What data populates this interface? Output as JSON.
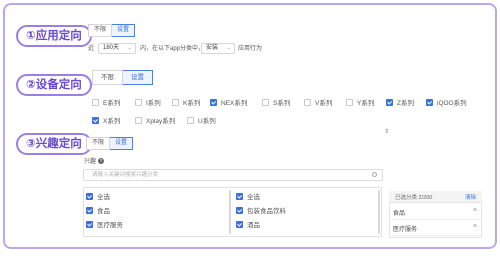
{
  "sections": {
    "app_targeting": "①应用定向",
    "device_targeting": "②设备定向",
    "interest_targeting": "③兴趣定向"
  },
  "app": {
    "options": [
      "不限",
      "设置"
    ],
    "selected": "设置",
    "rule_prefix": "近",
    "days_value": "180天",
    "rule_middle": "内，在以下app分类中，有",
    "action_value": "安装",
    "rule_suffix": "应用行为"
  },
  "device": {
    "options": [
      "不限",
      "设置"
    ],
    "selected": "设置",
    "series": [
      {
        "label": "E系列",
        "checked": false
      },
      {
        "label": "I系列",
        "checked": false
      },
      {
        "label": "K系列",
        "checked": false
      },
      {
        "label": "NEX系列",
        "checked": true
      },
      {
        "label": "S系列",
        "checked": false
      },
      {
        "label": "V系列",
        "checked": false
      },
      {
        "label": "Y系列",
        "checked": false
      },
      {
        "label": "Z系列",
        "checked": true
      },
      {
        "label": "iQOO系列",
        "checked": true
      },
      {
        "label": "X系列",
        "checked": true
      },
      {
        "label": "Xplay系列",
        "checked": false
      },
      {
        "label": "U系列",
        "checked": false
      }
    ]
  },
  "interest": {
    "options": [
      "不限",
      "设置"
    ],
    "selected": "设置",
    "field_label": "兴趣",
    "search_placeholder": "请输入关键词搜索兴趣分类",
    "col1": [
      {
        "label": "全选",
        "checked": true
      },
      {
        "label": "食品",
        "checked": true
      },
      {
        "label": "医疗服务",
        "checked": true
      }
    ],
    "col2": [
      {
        "label": "全选",
        "checked": true
      },
      {
        "label": "包装食品饮料",
        "checked": true
      },
      {
        "label": "酒品",
        "checked": true
      }
    ],
    "selected_panel": {
      "title": "已选分类 2/200",
      "clear_label": "清除",
      "items": [
        "食品",
        "医疗服务"
      ]
    }
  },
  "colors": {
    "accent": "#3b6fe0",
    "label_purple": "#6a48d8",
    "frame": "#b9a8ec"
  }
}
